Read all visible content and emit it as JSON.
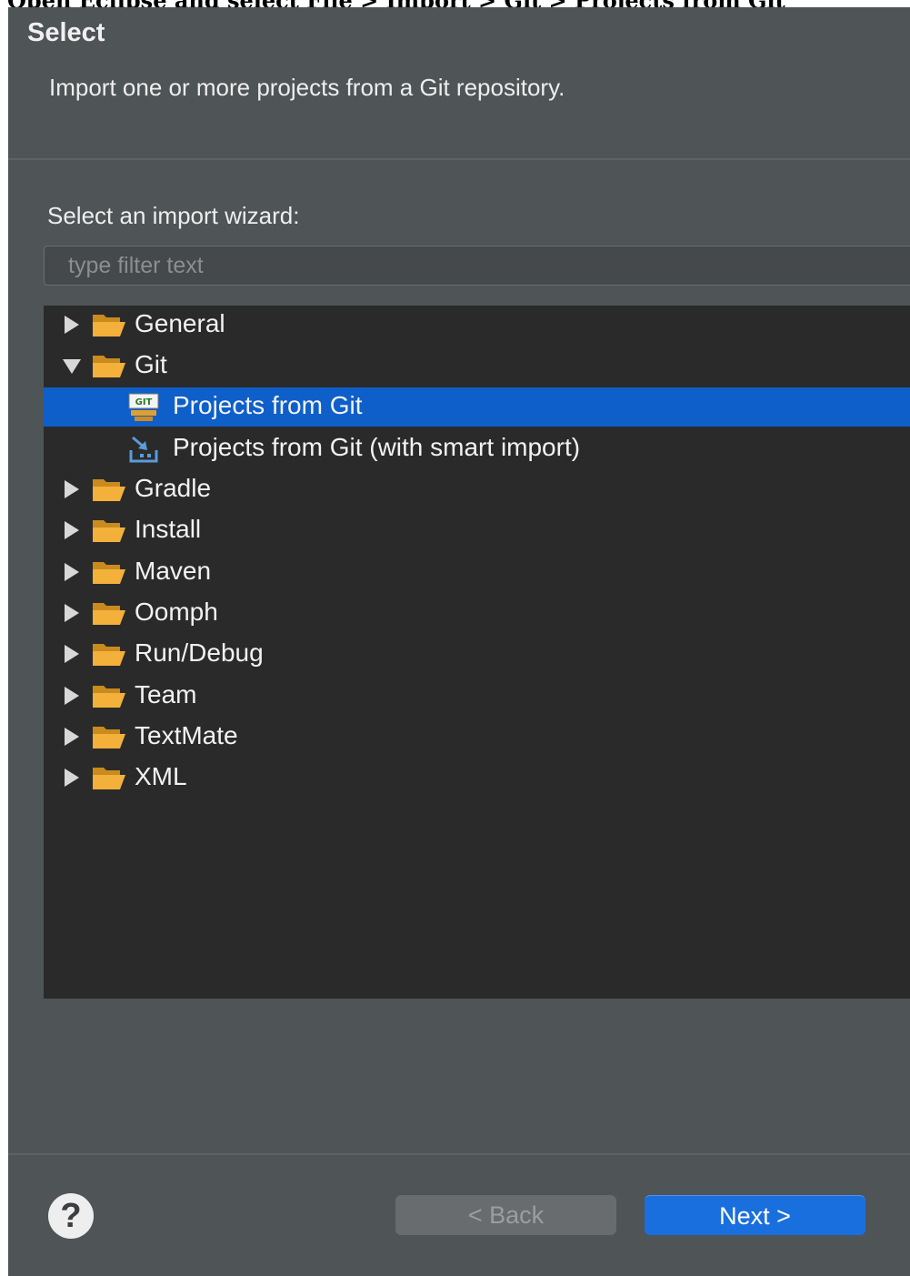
{
  "caption": "Open Eclipse and select File > Import > Git > Projects from Git",
  "dialog": {
    "title": "Select",
    "description": "Import one or more projects from a Git repository.",
    "wizard_label": "Select an import wizard:",
    "filter": {
      "placeholder": "type filter text",
      "value": ""
    }
  },
  "tree": {
    "items": [
      {
        "label": "General",
        "expanded": false
      },
      {
        "label": "Git",
        "expanded": true
      },
      {
        "label": "Projects from Git",
        "selected": true,
        "icon": "git-repo-icon"
      },
      {
        "label": "Projects from Git (with smart import)",
        "icon": "smart-import-icon"
      },
      {
        "label": "Gradle",
        "expanded": false
      },
      {
        "label": "Install",
        "expanded": false
      },
      {
        "label": "Maven",
        "expanded": false
      },
      {
        "label": "Oomph",
        "expanded": false
      },
      {
        "label": "Run/Debug",
        "expanded": false
      },
      {
        "label": "Team",
        "expanded": false
      },
      {
        "label": "TextMate",
        "expanded": false
      },
      {
        "label": "XML",
        "expanded": false
      }
    ]
  },
  "buttons": {
    "help": "?",
    "back": "< Back",
    "next": "Next >"
  },
  "colors": {
    "dialog_bg": "#4f5456",
    "tree_bg": "#2a2a2a",
    "selection": "#0e5fc9",
    "next_button": "#1a6fdf",
    "folder": "#f0a830"
  }
}
